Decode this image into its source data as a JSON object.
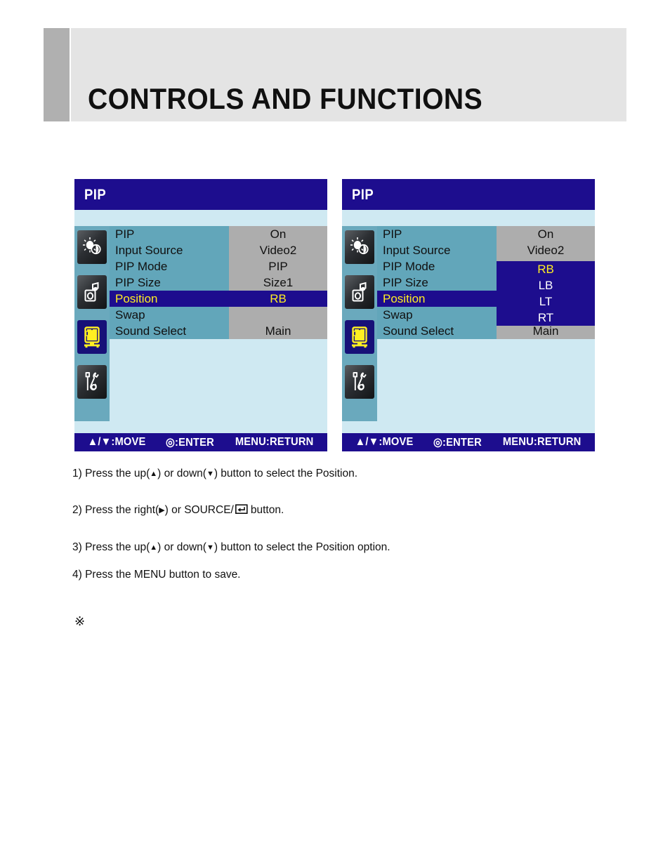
{
  "header": {
    "title": "CONTROLS AND FUNCTIONS",
    "accent_color": "#b0b0b0",
    "background_color": "#e4e4e4"
  },
  "colors": {
    "osd_navy": "#1d0d8e",
    "osd_body": "#cfe9f2",
    "label_teal": "#62a6ba",
    "value_gray": "#adadad",
    "highlight_yellow": "#ffee22"
  },
  "osd_panels": [
    {
      "id": "left",
      "title": "PIP",
      "sidebar_icons": [
        {
          "name": "brightness-contrast-icon",
          "active": false
        },
        {
          "name": "audio-icon",
          "active": false
        },
        {
          "name": "pip-monitor-icon",
          "active": true
        },
        {
          "name": "setup-tools-icon",
          "active": false
        }
      ],
      "rows": [
        {
          "label": "PIP",
          "value": "On",
          "highlight": false
        },
        {
          "label": "Input Source",
          "value": "Video2",
          "highlight": false
        },
        {
          "label": "PIP Mode",
          "value": "PIP",
          "highlight": false
        },
        {
          "label": "PIP Size",
          "value": "Size1",
          "highlight": false
        },
        {
          "label": "Position",
          "value": "RB",
          "highlight": true
        },
        {
          "label": "Swap",
          "value": "",
          "highlight": false
        },
        {
          "label": "Sound Select",
          "value": "Main",
          "highlight": false
        }
      ],
      "dropdown": null,
      "bottombar": {
        "move": "▲/▼:MOVE",
        "enter": "◎:ENTER",
        "return": "MENU:RETURN"
      }
    },
    {
      "id": "right",
      "title": "PIP",
      "sidebar_icons": [
        {
          "name": "brightness-contrast-icon",
          "active": false
        },
        {
          "name": "audio-icon",
          "active": false
        },
        {
          "name": "pip-monitor-icon",
          "active": true
        },
        {
          "name": "setup-tools-icon",
          "active": false
        }
      ],
      "rows": [
        {
          "label": "PIP",
          "value": "On",
          "highlight": false
        },
        {
          "label": "Input Source",
          "value": "Video2",
          "highlight": false
        },
        {
          "label": "PIP Mode",
          "value": "",
          "highlight": false
        },
        {
          "label": "PIP Size",
          "value": "",
          "highlight": false
        },
        {
          "label": "Position",
          "value": "",
          "highlight": true
        },
        {
          "label": "Swap",
          "value": "",
          "highlight": false
        },
        {
          "label": "Sound Select",
          "value": "Main",
          "highlight": false
        }
      ],
      "dropdown": {
        "options": [
          "RB",
          "LB",
          "LT",
          "RT"
        ],
        "selected": "RB"
      },
      "bottombar": {
        "move": "▲/▼:MOVE",
        "enter": "◎:ENTER",
        "return": "MENU:RETURN"
      }
    }
  ],
  "instructions": {
    "step1_a": "1) Press the up(",
    "step1_up": "▲",
    "step1_b": ") or down(",
    "step1_down": "▼",
    "step1_c": ") button to select the Position.",
    "step2_a": "2) Press the right(",
    "step2_right": "▶",
    "step2_b": ") or SOURCE/",
    "step2_c": "button.",
    "step3_a": "3) Press the up(",
    "step3_up": "▲",
    "step3_b": ") or down(",
    "step3_down": "▼",
    "step3_c": ") button to select the Position option.",
    "step4": "4) Press the MENU button to save.",
    "note_mark": "※"
  }
}
